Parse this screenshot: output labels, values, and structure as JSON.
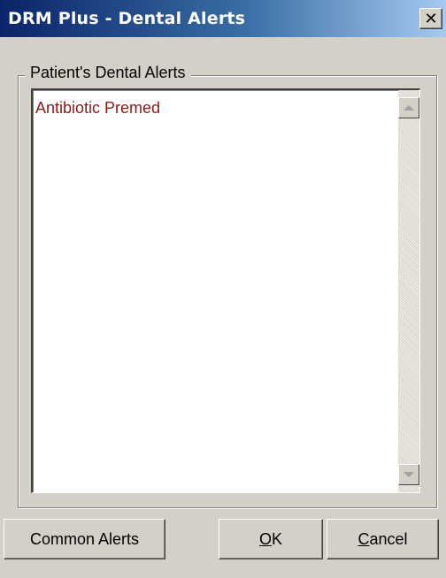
{
  "window": {
    "title": "DRM Plus - Dental Alerts",
    "close_glyph": "✕"
  },
  "group": {
    "legend": "Patient's Dental Alerts"
  },
  "alerts": {
    "items": [
      "Antibiotic Premed"
    ],
    "item_color": "#8b1a1a"
  },
  "buttons": {
    "common_alerts": "Common Alerts",
    "ok_mnemonic": "O",
    "ok_rest": "K",
    "cancel_mnemonic": "C",
    "cancel_rest": "ancel"
  },
  "colors": {
    "title_gradient_start": "#0a246a",
    "title_gradient_end": "#a6caf0",
    "dialog_face": "#d4d0c8"
  }
}
